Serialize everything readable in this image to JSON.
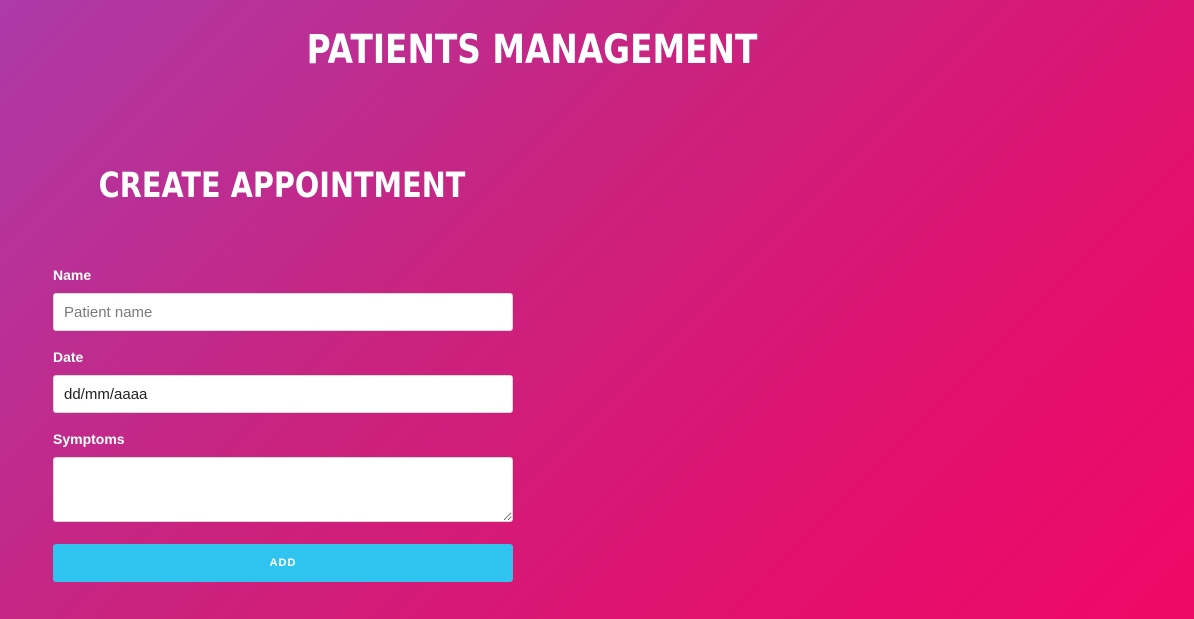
{
  "header": {
    "title": "PATIENTS MANAGEMENT"
  },
  "form": {
    "title": "CREATE APPOINTMENT",
    "name_label": "Name",
    "name_placeholder": "Patient name",
    "date_label": "Date",
    "date_value": "dd/mm/aaaa",
    "symptoms_label": "Symptoms",
    "symptoms_value": "",
    "submit_label": "ADD"
  },
  "colors": {
    "gradient_start": "#ad3aa8",
    "gradient_end": "#f00866",
    "button": "#2fc3ef",
    "text": "#ffffff"
  }
}
